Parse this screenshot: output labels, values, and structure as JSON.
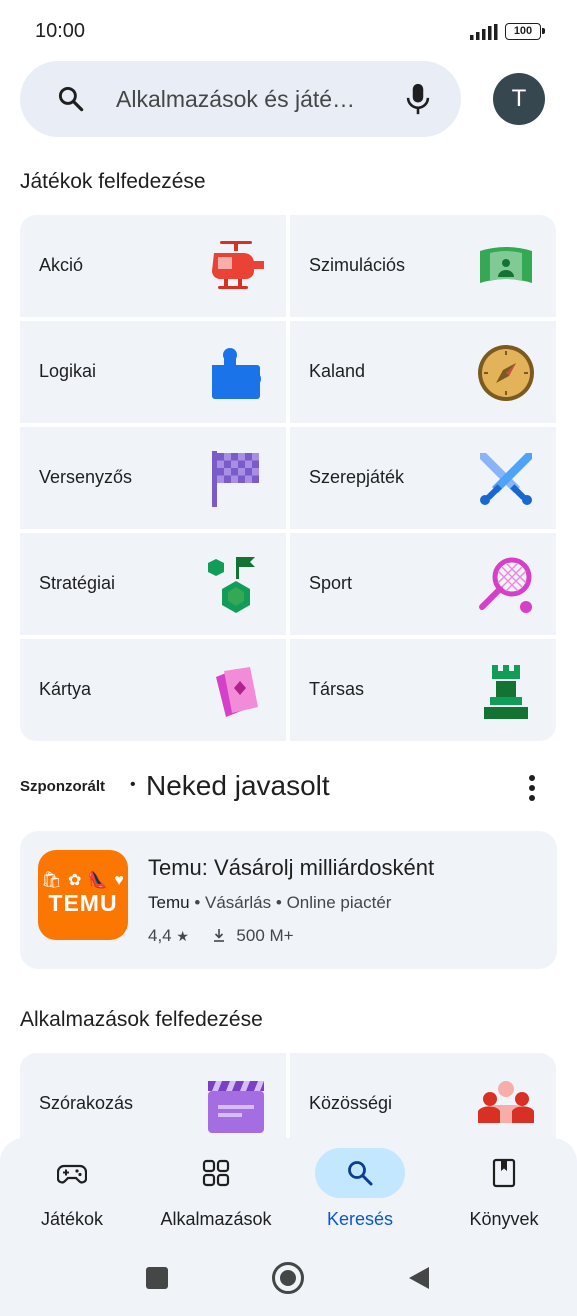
{
  "status": {
    "time": "10:00",
    "battery": "100"
  },
  "search": {
    "placeholder": "Alkalmazások és játé…"
  },
  "account": {
    "initial": "T"
  },
  "games_section": {
    "title": "Játékok felfedezése",
    "tiles": [
      {
        "label": "Akció",
        "icon": "helicopter-icon"
      },
      {
        "label": "Szimulációs",
        "icon": "simulation-icon"
      },
      {
        "label": "Logikai",
        "icon": "puzzle-icon"
      },
      {
        "label": "Kaland",
        "icon": "compass-icon"
      },
      {
        "label": "Versenyzős",
        "icon": "checkered-flag-icon"
      },
      {
        "label": "Szerepjáték",
        "icon": "crossed-swords-icon"
      },
      {
        "label": "Stratégiai",
        "icon": "strategy-icon"
      },
      {
        "label": "Sport",
        "icon": "tennis-racket-icon"
      },
      {
        "label": "Kártya",
        "icon": "cards-icon"
      },
      {
        "label": "Társas",
        "icon": "chess-rook-icon"
      }
    ]
  },
  "sponsored": {
    "label": "Szponzorált",
    "dot": "•",
    "title": "Neked javasolt",
    "app": {
      "name": "Temu: Vásárolj milliárdosként",
      "developer": "Temu",
      "category": "Vásárlás",
      "subcategory": "Online piactér",
      "separator": "•",
      "rating": "4,4",
      "rating_star": "★",
      "downloads": "500 M+",
      "icon_glyphs": "🛍 ✿ 👠 ♥",
      "icon_word": "TEMU"
    }
  },
  "apps_section": {
    "title": "Alkalmazások felfedezése",
    "tiles": [
      {
        "label": "Szórakozás",
        "icon": "clapperboard-icon"
      },
      {
        "label": "Közösségi",
        "icon": "people-icon"
      }
    ]
  },
  "bottom_nav": [
    {
      "label": "Játékok",
      "icon": "gamepad-icon",
      "active": false
    },
    {
      "label": "Alkalmazások",
      "icon": "apps-grid-icon",
      "active": false
    },
    {
      "label": "Keresés",
      "icon": "search-icon",
      "active": true
    },
    {
      "label": "Könyvek",
      "icon": "book-icon",
      "active": false
    }
  ],
  "colors": {
    "accent": "#0b57d0",
    "active_pill": "#c2e7ff",
    "surface": "#f0f4f9",
    "temu_orange": "#fb7701"
  }
}
